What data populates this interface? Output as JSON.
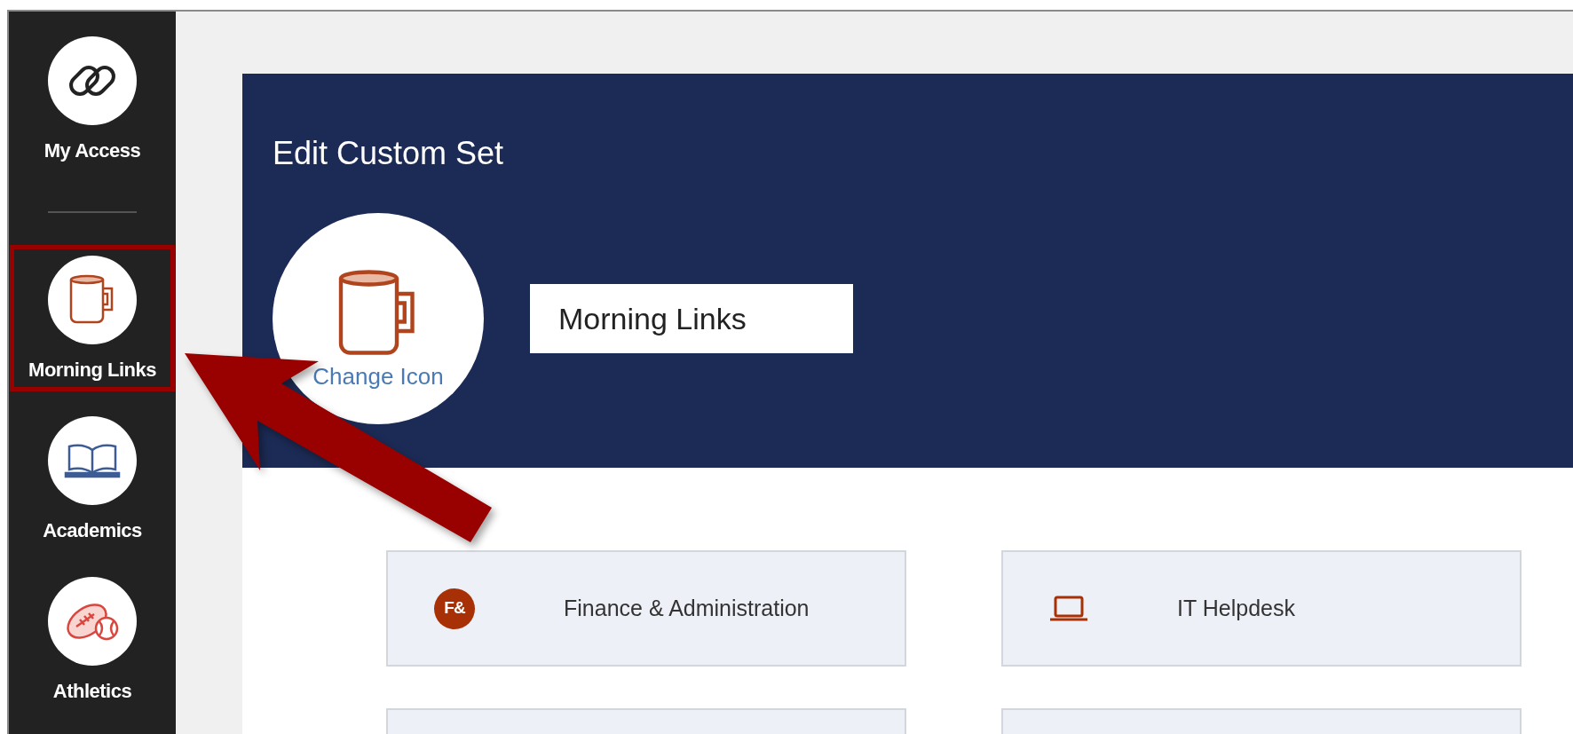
{
  "sidebar": {
    "items": [
      {
        "label": "My Access",
        "highlighted": false
      },
      {
        "kind": "divider"
      },
      {
        "label": "Morning Links",
        "highlighted": true
      },
      {
        "label": "Academics",
        "highlighted": false
      },
      {
        "label": "Athletics",
        "highlighted": false
      }
    ]
  },
  "header": {
    "title": "Edit Custom Set",
    "change_icon": "Change Icon",
    "name_field": {
      "value": "Morning Links"
    }
  },
  "tiles": [
    {
      "kind": "badge",
      "badge_text": "F&",
      "label": "Finance & Administration"
    },
    {
      "kind": "laptop",
      "label": "IT Helpdesk"
    },
    {
      "kind": "cut-off"
    },
    {
      "kind": "cut-off"
    }
  ],
  "annotation": {
    "arrow": true
  }
}
